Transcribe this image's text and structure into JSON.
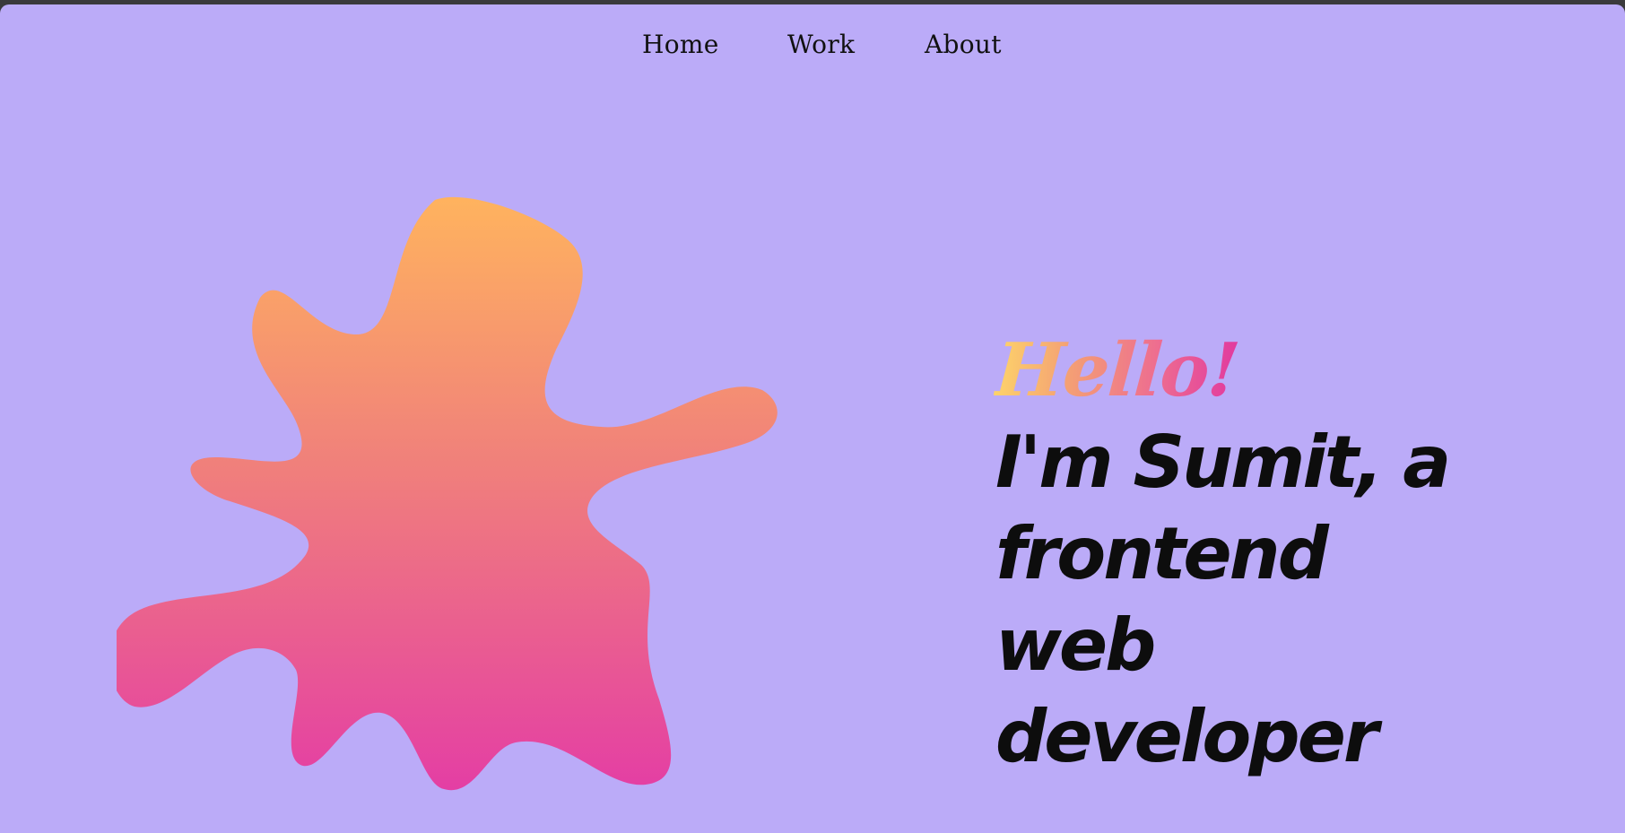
{
  "nav": {
    "items": [
      {
        "label": "Home"
      },
      {
        "label": "Work"
      },
      {
        "label": "About"
      }
    ]
  },
  "hero": {
    "greeting": "Hello!",
    "headline": "I'm Sumit, a frontend web developer"
  },
  "colors": {
    "background": "#bbabf8",
    "blob_gradient_top": "#ffb35e",
    "blob_gradient_mid": "#f0807b",
    "blob_gradient_bottom": "#e43ea4",
    "greeting_gradient": [
      "#fdd36a",
      "#f4a074",
      "#ee6f8f",
      "#e1399f"
    ],
    "text": "#0d0d0d"
  }
}
